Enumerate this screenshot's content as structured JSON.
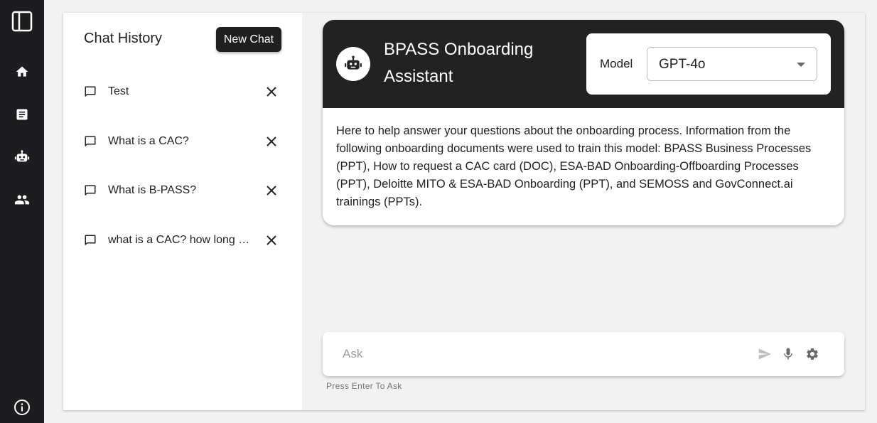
{
  "rail": {
    "items": [
      "sidebar-toggle",
      "home",
      "documents",
      "assistant",
      "users",
      "info"
    ]
  },
  "history": {
    "title": "Chat History",
    "new_chat_label": "New Chat",
    "items": [
      {
        "label": "Test"
      },
      {
        "label": "What is a CAC?"
      },
      {
        "label": "What is B-PASS?"
      },
      {
        "label": "what is a CAC? how long does it take to get one?"
      }
    ]
  },
  "assistant": {
    "title": "BPASS Onboarding Assistant",
    "model_label": "Model",
    "model_value": "GPT-4o",
    "description": "Here to help answer your questions about the onboarding process. Information from the following onboarding documents were used to train this model: BPASS Business Processes (PPT), How to request a CAC card (DOC), ESA-BAD Onboarding-Offboarding Processes (PPT), Deloitte MITO & ESA-BAD Onboarding (PPT), and SEMOSS and GovConnect.ai trainings (PPTs)."
  },
  "ask": {
    "placeholder": "Ask",
    "value": "",
    "hint": "Press Enter To Ask"
  },
  "icons": {
    "sidebar_toggle": "sidebar-toggle-icon",
    "home": "home-icon",
    "documents": "document-icon",
    "assistant": "robot-icon",
    "users": "people-icon",
    "info": "info-icon",
    "chat": "chat-bubble-icon",
    "close": "close-icon",
    "send": "send-icon",
    "mic": "microphone-icon",
    "settings": "gear-icon"
  },
  "colors": {
    "rail": "#1d1d1f",
    "header": "#222222",
    "button": "#1f1f1f",
    "background": "#f2f2f2"
  }
}
